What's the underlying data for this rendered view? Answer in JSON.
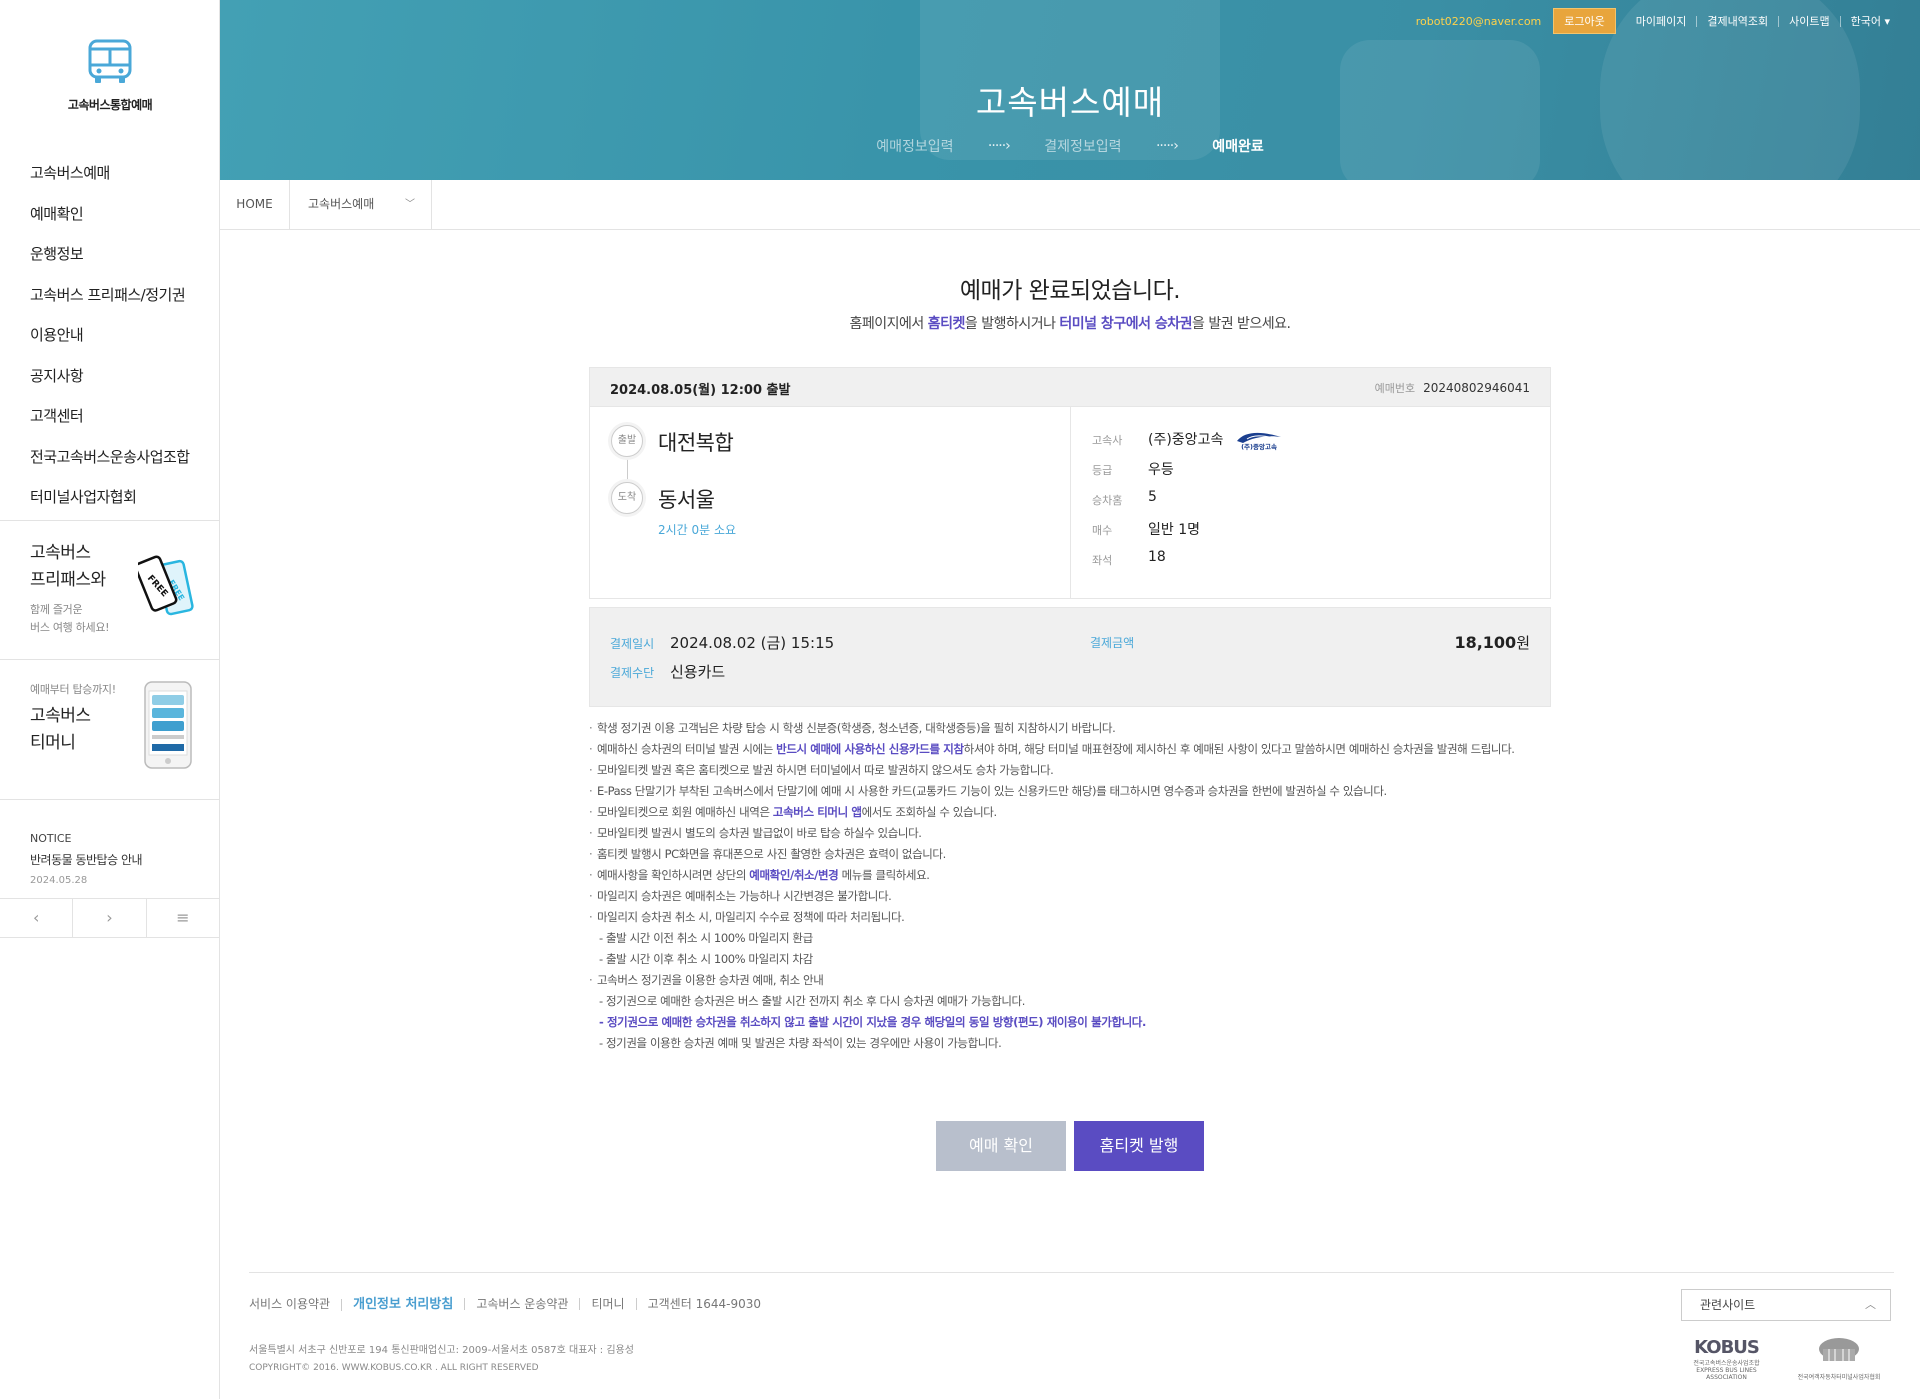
{
  "sidebar": {
    "logo_text": "고속버스통합예매",
    "menu": [
      "고속버스예매",
      "예매확인",
      "운행정보",
      "고속버스 프리패스/정기권",
      "이용안내",
      "공지사항",
      "고객센터",
      "전국고속버스운송사업조합",
      "터미널사업자협회"
    ],
    "promo1": {
      "title1": "고속버스",
      "title2": "프리패스와",
      "sub1": "함께 즐거운",
      "sub2": "버스 여행 하세요!",
      "icon": "free-pass-ticket-icon",
      "ticket_text": "FREE"
    },
    "promo2": {
      "sub": "예매부터 탑승까지!",
      "title1": "고속버스",
      "title2": "티머니",
      "icon": "smartphone-app-icon"
    },
    "notice": {
      "label": "NOTICE",
      "title": "반려동물 동반탑승 안내",
      "date": "2024.05.28",
      "prev": "‹",
      "next": "›",
      "list": "≡"
    }
  },
  "header": {
    "email": "robot0220@naver.com",
    "logout": "로그아웃",
    "nav": [
      "마이페이지",
      "결제내역조회",
      "사이트맵",
      "한국어"
    ],
    "lang_arrow": "▾",
    "title": "고속버스예매",
    "steps": [
      "예매정보입력",
      "결제정보입력",
      "예매완료"
    ],
    "step_arrow": "·····›",
    "active_step": 2,
    "colors": {
      "banner": "#3a94aa",
      "accent": "#5a4cc2",
      "logout": "#e8a53c"
    }
  },
  "breadcrumb": {
    "home": "HOME",
    "current": "고속버스예매",
    "chevron": "﹀"
  },
  "main": {
    "title": "예매가 완료되었습니다.",
    "subtitle": {
      "p1": "홈페이지에서 ",
      "h1": "홈티켓",
      "p2": "을 발행하시거나 ",
      "h2": "터미널 창구에서 승차권",
      "p3": "을 발권 받으세요."
    },
    "ticket": {
      "departure": "2024.08.05(월) 12:00 출발",
      "reservation_label": "예매번호",
      "reservation_no": "20240802946041",
      "dep_badge": "출발",
      "dep_name": "대전복합",
      "arr_badge": "도착",
      "arr_name": "동서울",
      "duration": "2시간 0분 소요",
      "company_label": "고속사",
      "company": "(주)중앙고속",
      "company_logo_text": "(주)중앙고속",
      "grade_label": "등급",
      "grade": "우등",
      "car_label": "승차홈",
      "car": "5",
      "count_label": "매수",
      "count": "일반 1명",
      "seat_label": "좌석",
      "seat": "18"
    },
    "payment": {
      "date_label": "결제일시",
      "date": "2024.08.02 (금) 15:15",
      "method_label": "결제수단",
      "method": "신용카드",
      "amount_label": "결제금액",
      "amount": "18,100",
      "unit": "원"
    },
    "notes": {
      "n1": "학생 정기권 이용 고객님은 차량 탑승 시 학생 신분증(학생증, 청소년증, 대학생증등)을 필히 지참하시기 바랍니다.",
      "n2a": "예매하신 승차권의 터미널 발권 시에는 ",
      "n2b": "반드시 예매에 사용하신 신용카드를 지참",
      "n2c": "하셔야 하며, 해당 터미널 매표현장에 제시하신 후 예매된 사항이 있다고 말씀하시면 예매하신 승차권을 발권해 드립니다.",
      "n3": "모바일티켓 발권 혹은 홈티켓으로 발권 하시면 터미널에서 따로 발권하지 않으셔도 승차 가능합니다.",
      "n4": "E-Pass 단말기가 부착된 고속버스에서 단말기에 예매 시 사용한 카드(교통카드 기능이 있는 신용카드만 해당)를 태그하시면 영수증과 승차권을 한번에 발권하실 수 있습니다.",
      "n5a": "모바일티켓으로 회원 예매하신 내역은 ",
      "n5b": "고속버스 티머니 앱",
      "n5c": "에서도 조회하실 수 있습니다.",
      "n6": "모바일티켓 발권시 별도의 승차권 발급없이 바로 탑승 하실수 있습니다.",
      "n7": "홈티켓 발행시 PC화면을 휴대폰으로 사진 촬영한 승차권은 효력이 없습니다.",
      "n8a": "예매사항을 확인하시려면 상단의 ",
      "n8b": "예매확인/취소/변경",
      "n8c": " 메뉴를 클릭하세요.",
      "n9": "마일리지 승차권은 예매취소는 가능하나 시간변경은 불가합니다.",
      "n10": "마일리지 승차권 취소 시, 마일리지 수수료 정책에 따라 처리됩니다.",
      "n10a": "- 출발 시간 이전 취소 시 100% 마일리지 환급",
      "n10b": "- 출발 시간 이후 취소 시 100% 마일리지 차감",
      "n11": "고속버스 정기권을 이용한 승차권 예매, 취소 안내",
      "n11a": "- 정기권으로 예매한 승차권은 버스 출발 시간 전까지 취소 후 다시 승차권 예매가 가능합니다.",
      "n11b": "- 정기권으로 예매한 승차권을 취소하지 않고 출발 시간이 지났을 경우 해당일의 동일 방향(편도) 재이용이 불가합니다.",
      "n11c": "- 정기권을 이용한 승차권 예매 및 발권은 차량 좌석이 있는 경우에만 사용이 가능합니다."
    },
    "buttons": {
      "confirm": "예매 확인",
      "issue": "홈티켓 발행"
    }
  },
  "footer": {
    "links": [
      "서비스 이용약관",
      "개인정보 처리방침",
      "고속버스 운송약관",
      "티머니",
      "고객센터 1644-9030"
    ],
    "address": "서울특별시 서초구 신반포로 194 통신판매업신고: 2009-서울서초 0587호 대표자 : 김용성",
    "copyright": "COPYRIGHT© 2016. WWW.KOBUS.CO.KR . ALL RIGHT RESERVED",
    "related": "관련사이트",
    "related_chevron": "︿",
    "kobus": "KOBUS",
    "kobus_sub": "전국고속버스운송사업조합",
    "kobus_en": "EXPRESS BUS LINES ASSOCIATION",
    "assoc_sub": "전국여객자동차터미널사업자협회"
  }
}
